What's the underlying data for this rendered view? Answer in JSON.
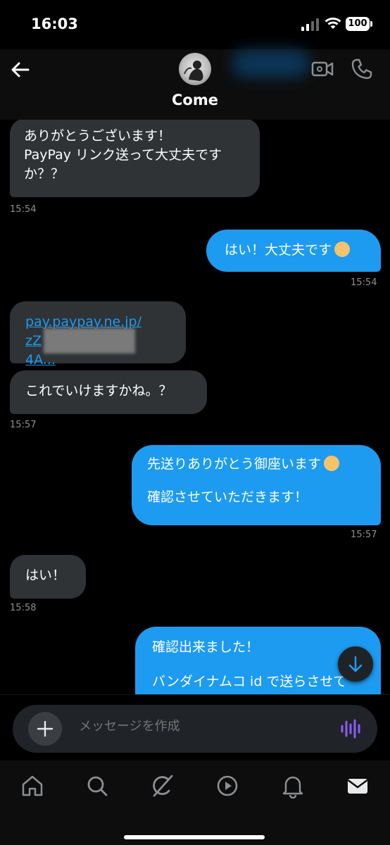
{
  "status": {
    "time": "16:03",
    "battery": "100"
  },
  "header": {
    "contact_name": "Come"
  },
  "messages": [
    {
      "text": "ありがとうございます！\nPayPay リンク送って大丈夫です\nか？？",
      "time": "15:54"
    },
    {
      "text": "はい！大丈夫です",
      "time": "15:54"
    },
    {
      "link_line1": "pay.paypay.ne.jp/",
      "link_line2_start": "zZ",
      "link_line2_end": "4A..."
    },
    {
      "text": "これでいけますかね。？",
      "time": "15:57"
    },
    {
      "text": "先送りありがとう御座います",
      "text2": "確認させていただきます！",
      "time": "15:57"
    },
    {
      "text": "はい！",
      "time": "15:58"
    },
    {
      "text": "確認出来ました！",
      "text2": "バンダイナムコ id で送らさせて"
    }
  ],
  "composer": {
    "placeholder": "メッセージを作成"
  },
  "nav": {
    "items": [
      "home-icon",
      "search-icon",
      "grok-icon",
      "media-icon",
      "notifications-icon",
      "messages-icon"
    ]
  },
  "colors": {
    "outgoing": "#1d9bf0",
    "incoming": "#2f3336",
    "voice_accent": "#8b5cf6"
  }
}
